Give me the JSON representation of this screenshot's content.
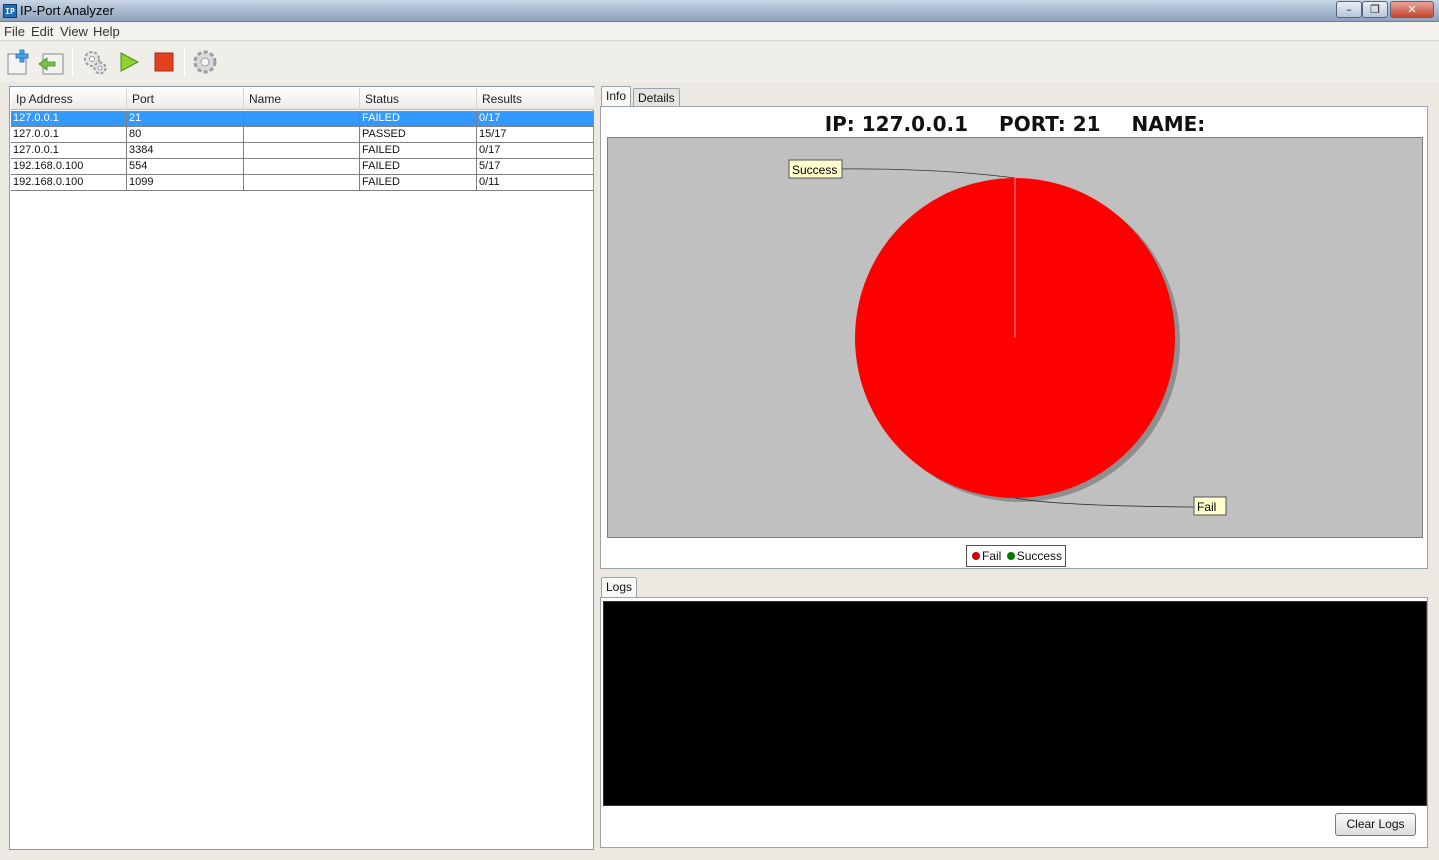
{
  "window": {
    "title": "IP-Port Analyzer",
    "icon_text": "IP",
    "controls": [
      "minimize-icon",
      "maximize-icon",
      "close-icon"
    ]
  },
  "menu": {
    "items": [
      {
        "label": "File"
      },
      {
        "label": "Edit"
      },
      {
        "label": "View"
      },
      {
        "label": "Help"
      }
    ]
  },
  "toolbar": {
    "buttons": [
      {
        "name": "new-icon"
      },
      {
        "name": "import-icon"
      },
      {
        "name": "gears-icon"
      },
      {
        "name": "play-icon"
      },
      {
        "name": "stop-icon"
      },
      {
        "name": "settings-gear-icon"
      }
    ]
  },
  "table": {
    "columns": [
      "Ip Address",
      "Port",
      "Name",
      "Status",
      "Results"
    ],
    "rows": [
      {
        "ip": "127.0.0.1",
        "port": "21",
        "name": "",
        "status": "FAILED",
        "results": "0/17",
        "selected": true
      },
      {
        "ip": "127.0.0.1",
        "port": "80",
        "name": "",
        "status": "PASSED",
        "results": "15/17",
        "selected": false
      },
      {
        "ip": "127.0.0.1",
        "port": "3384",
        "name": "",
        "status": "FAILED",
        "results": "0/17",
        "selected": false
      },
      {
        "ip": "192.168.0.100",
        "port": "554",
        "name": "",
        "status": "FAILED",
        "results": "5/17",
        "selected": false
      },
      {
        "ip": "192.168.0.100",
        "port": "1099",
        "name": "",
        "status": "FAILED",
        "results": "0/11",
        "selected": false
      }
    ]
  },
  "tabs": {
    "info": "Info",
    "details": "Details"
  },
  "info": {
    "ip_label": "IP: 127.0.0.1",
    "port_label": "PORT: 21",
    "name_label": "NAME:"
  },
  "chart_data": {
    "type": "pie",
    "categories": [
      "Fail",
      "Success"
    ],
    "values": [
      17,
      0
    ],
    "colors": {
      "Fail": "#ff0000",
      "Success": "#008000"
    },
    "slice_labels": [
      "Success",
      "Fail"
    ],
    "legend": [
      {
        "label": "Fail",
        "color": "#cc0000"
      },
      {
        "label": "Success",
        "color": "#007a00"
      }
    ],
    "legend_position": "bottom",
    "background": "#c0c0c0"
  },
  "logs": {
    "tab_label": "Logs",
    "content": "",
    "clear_button": "Clear Logs"
  },
  "colors": {
    "selection": "#3399ff",
    "logs_background": "#000000"
  }
}
